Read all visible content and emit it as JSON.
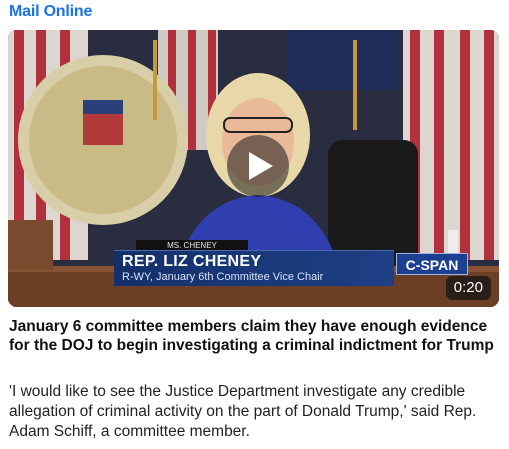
{
  "source": {
    "name": "Mail Online",
    "color": "#1a73e8"
  },
  "video": {
    "duration": "0:20",
    "play_icon": "play-icon",
    "lower_third": {
      "name": "REP. LIZ CHENEY",
      "title": "R-WY, January 6th Committee Vice Chair"
    },
    "nameplate": "MS. CHENEY",
    "network_logo": "C-SPAN"
  },
  "article": {
    "headline": "January 6 committee members claim they have enough evidence for the DOJ to begin investigating a criminal indictment for Trump",
    "summary": "'I would like to see the Justice Department investigate any credible allegation of criminal activity on the part of Donald Trump,' said Rep. Adam Schiff, a committee member."
  }
}
